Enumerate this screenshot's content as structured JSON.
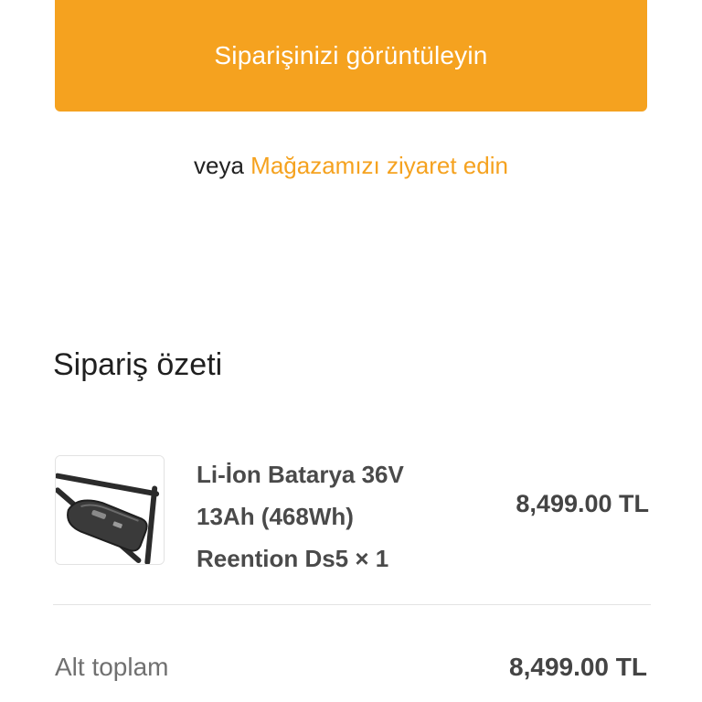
{
  "view_order_button": {
    "label": "Siparişinizi görüntüleyin"
  },
  "alternative": {
    "prefix": "veya",
    "link_label": "Mağazamızı ziyaret edin"
  },
  "order_summary": {
    "title": "Sipariş özeti",
    "items": [
      {
        "name_line_1": "Li-İon Batarya 36V",
        "name_line_2": "13Ah (468Wh)",
        "name_line_3": "Reention Ds5 × 1",
        "price": "8,499.00 TL",
        "thumbnail_icon": "battery-frame-image"
      }
    ],
    "subtotal": {
      "label": "Alt toplam",
      "value": "8,499.00 TL"
    }
  },
  "colors": {
    "accent": "#f5a21f",
    "text_dark": "#1f1f1f",
    "text_muted": "#707070",
    "divider": "#e3e3e3"
  }
}
